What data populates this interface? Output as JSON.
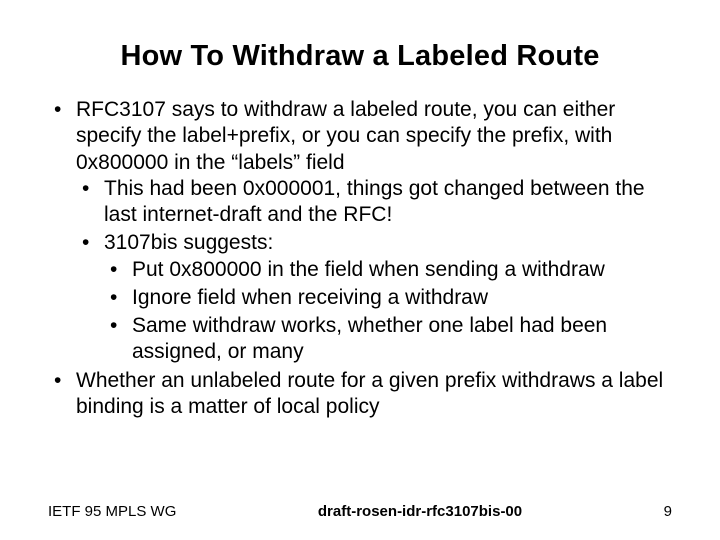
{
  "title": "How To Withdraw a Labeled Route",
  "bullets": {
    "b1": "RFC3107 says to withdraw a labeled route, you can either specify the label+prefix, or you can specify the prefix, with 0x800000 in the “labels” field",
    "b1a": "This had been 0x000001, things got changed between the last internet-draft and the RFC!",
    "b1b": "3107bis suggests:",
    "b1b1": "Put 0x800000 in the field when sending a withdraw",
    "b1b2": "Ignore field when receiving a withdraw",
    "b1b3": "Same withdraw works, whether one label had been assigned, or many",
    "b2": "Whether an unlabeled route for a given prefix withdraws a label binding is a matter of local policy"
  },
  "footer": {
    "left": "IETF 95 MPLS WG",
    "center": "draft-rosen-idr-rfc3107bis-00",
    "right": "9"
  }
}
